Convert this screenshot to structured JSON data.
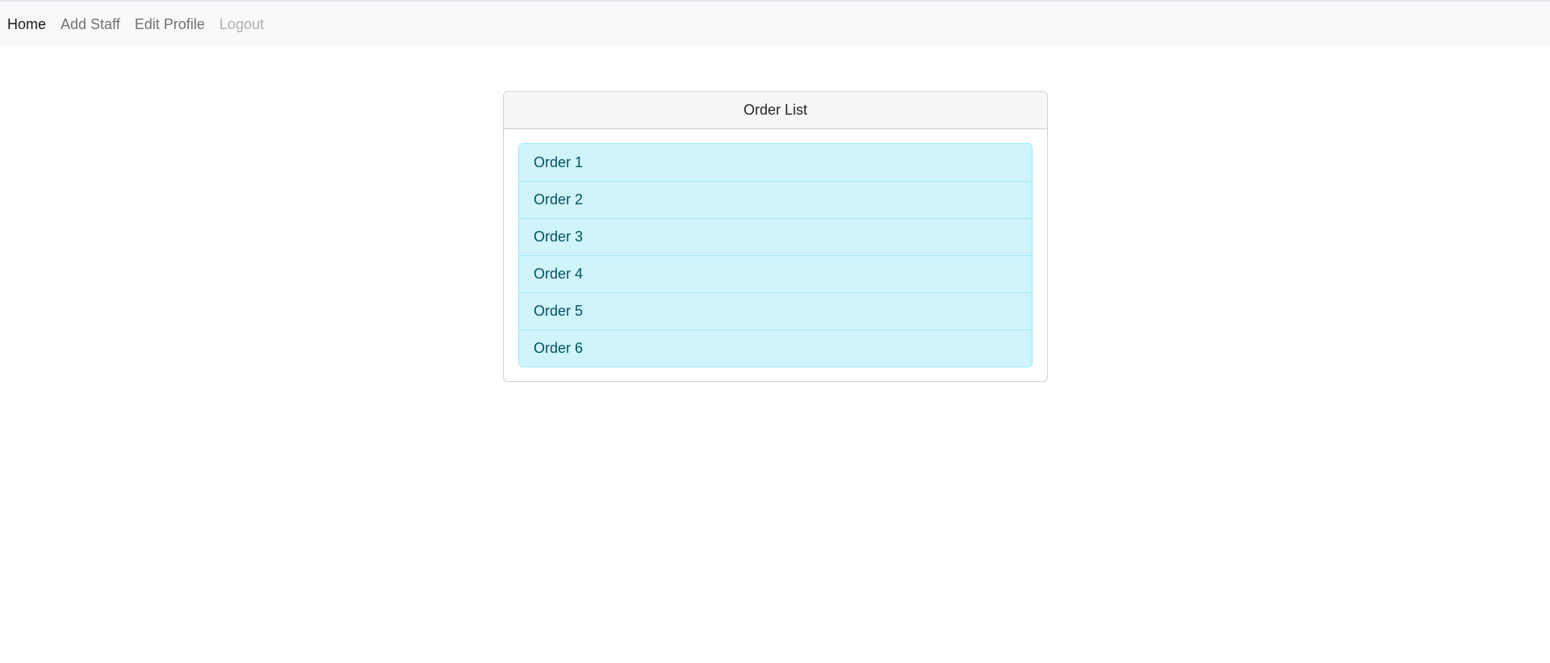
{
  "nav": {
    "items": [
      {
        "label": "Home",
        "state": "active"
      },
      {
        "label": "Add Staff",
        "state": "normal"
      },
      {
        "label": "Edit Profile",
        "state": "normal"
      },
      {
        "label": "Logout",
        "state": "disabled"
      }
    ]
  },
  "card": {
    "header": "Order List",
    "orders": [
      "Order 1",
      "Order 2",
      "Order 3",
      "Order 4",
      "Order 5",
      "Order 6"
    ]
  },
  "colors": {
    "navbar_bg": "#f8f9fa",
    "list_item_bg": "#cff4fc",
    "list_item_text": "#055160",
    "list_border": "#9eeaf9",
    "card_header_bg": "#f7f7f7"
  }
}
